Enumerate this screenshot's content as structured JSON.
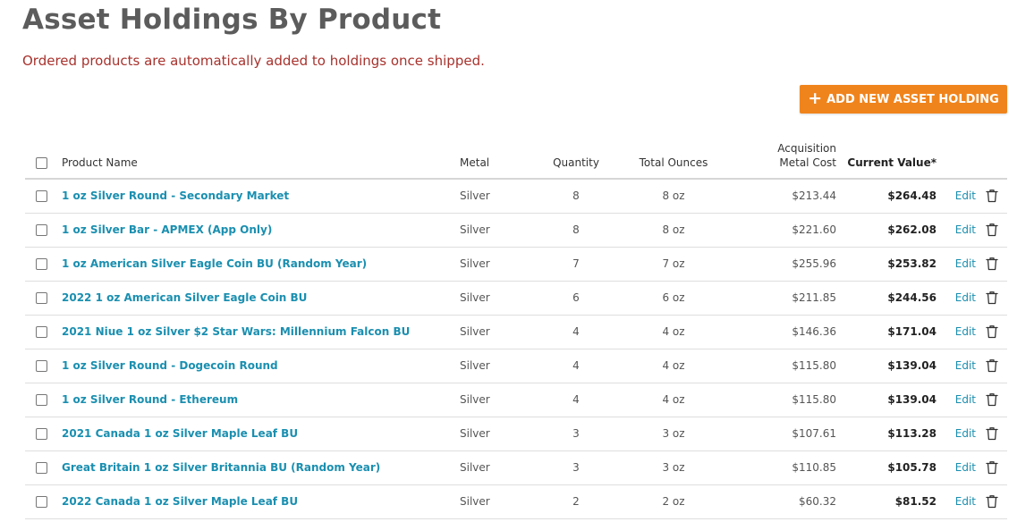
{
  "page": {
    "title": "Asset Holdings By Product",
    "notice": "Ordered products are automatically added to holdings once shipped."
  },
  "toolbar": {
    "add_label": "ADD NEW ASSET HOLDING",
    "add_icon": "plus-icon"
  },
  "colors": {
    "accent_orange": "#f0841c",
    "notice_red": "#a8322d",
    "link_blue": "#1a8fb0",
    "title_gray": "#5c5c5c"
  },
  "table": {
    "headers": {
      "product": "Product Name",
      "metal": "Metal",
      "quantity": "Quantity",
      "ounces": "Total Ounces",
      "cost_line1": "Acquisition",
      "cost_line2": "Metal Cost",
      "value": "Current Value*"
    },
    "rows": [
      {
        "name": "1 oz Silver Round - Secondary Market",
        "metal": "Silver",
        "quantity": "8",
        "ounces": "8 oz",
        "cost": "$213.44",
        "value": "$264.48",
        "edit": "Edit"
      },
      {
        "name": "1 oz Silver Bar - APMEX (App Only)",
        "metal": "Silver",
        "quantity": "8",
        "ounces": "8 oz",
        "cost": "$221.60",
        "value": "$262.08",
        "edit": "Edit"
      },
      {
        "name": "1 oz American Silver Eagle Coin BU (Random Year)",
        "metal": "Silver",
        "quantity": "7",
        "ounces": "7 oz",
        "cost": "$255.96",
        "value": "$253.82",
        "edit": "Edit"
      },
      {
        "name": "2022 1 oz American Silver Eagle Coin BU",
        "metal": "Silver",
        "quantity": "6",
        "ounces": "6 oz",
        "cost": "$211.85",
        "value": "$244.56",
        "edit": "Edit"
      },
      {
        "name": "2021 Niue 1 oz Silver $2 Star Wars: Millennium Falcon BU",
        "metal": "Silver",
        "quantity": "4",
        "ounces": "4 oz",
        "cost": "$146.36",
        "value": "$171.04",
        "edit": "Edit"
      },
      {
        "name": "1 oz Silver Round - Dogecoin Round",
        "metal": "Silver",
        "quantity": "4",
        "ounces": "4 oz",
        "cost": "$115.80",
        "value": "$139.04",
        "edit": "Edit"
      },
      {
        "name": "1 oz Silver Round - Ethereum",
        "metal": "Silver",
        "quantity": "4",
        "ounces": "4 oz",
        "cost": "$115.80",
        "value": "$139.04",
        "edit": "Edit"
      },
      {
        "name": "2021 Canada 1 oz Silver Maple Leaf BU",
        "metal": "Silver",
        "quantity": "3",
        "ounces": "3 oz",
        "cost": "$107.61",
        "value": "$113.28",
        "edit": "Edit"
      },
      {
        "name": "Great Britain 1 oz Silver Britannia BU (Random Year)",
        "metal": "Silver",
        "quantity": "3",
        "ounces": "3 oz",
        "cost": "$110.85",
        "value": "$105.78",
        "edit": "Edit"
      },
      {
        "name": "2022 Canada 1 oz Silver Maple Leaf BU",
        "metal": "Silver",
        "quantity": "2",
        "ounces": "2 oz",
        "cost": "$60.32",
        "value": "$81.52",
        "edit": "Edit"
      }
    ]
  }
}
